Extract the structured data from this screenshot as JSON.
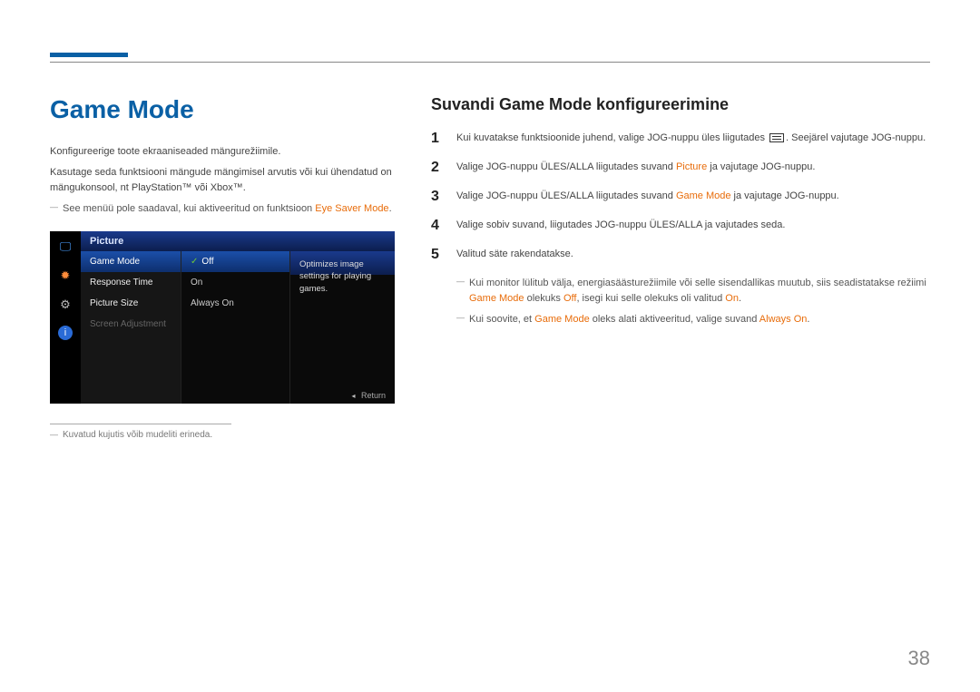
{
  "page_number": "38",
  "left": {
    "title": "Game Mode",
    "para1": "Konfigureerige toote ekraaniseaded mängurežiimile.",
    "para2": "Kasutage seda funktsiooni mängude mängimisel arvutis või kui ühendatud on mängukonsool, nt PlayStation™ või Xbox™.",
    "note1_pre": "See menüü pole saadaval, kui aktiveeritud on funktsioon ",
    "note1_orange": "Eye Saver Mode",
    "note1_post": ".",
    "footnote": "Kuvatud kujutis võib mudeliti erineda."
  },
  "osd": {
    "tab": "Picture",
    "menu": [
      "Game Mode",
      "Response Time",
      "Picture Size",
      "Screen Adjustment"
    ],
    "values": [
      "Off",
      "On",
      "Always On"
    ],
    "info": "Optimizes image settings for playing games.",
    "return": "Return"
  },
  "right": {
    "title": "Suvandi Game Mode konfigureerimine",
    "step1_pre": "Kui kuvatakse funktsioonide juhend, valige JOG-nuppu üles liigutades ",
    "step1_post": ". Seejärel vajutage JOG-nuppu.",
    "step2_pre": "Valige JOG-nuppu ÜLES/ALLA liigutades suvand ",
    "step2_orange": "Picture",
    "step2_post": " ja vajutage JOG-nuppu.",
    "step3_pre": "Valige JOG-nuppu ÜLES/ALLA liigutades suvand ",
    "step3_orange": "Game Mode",
    "step3_post": " ja vajutage JOG-nuppu.",
    "step4": "Valige sobiv suvand, liigutades JOG-nuppu ÜLES/ALLA ja vajutades seda.",
    "step5": "Valitud säte rakendatakse.",
    "noteA_pre": "Kui monitor lülitub välja, energiasäästurežiimile või selle sisendallikas muutub, siis seadistatakse režiimi ",
    "noteA_o1": "Game Mode",
    "noteA_mid": " olekuks ",
    "noteA_o2": "Off",
    "noteA_mid2": ", isegi kui selle olekuks oli valitud ",
    "noteA_o3": "On",
    "noteA_post": ".",
    "noteB_pre": "Kui soovite, et ",
    "noteB_o1": "Game Mode",
    "noteB_mid": " oleks alati aktiveeritud, valige suvand ",
    "noteB_o2": "Always On",
    "noteB_post": "."
  }
}
